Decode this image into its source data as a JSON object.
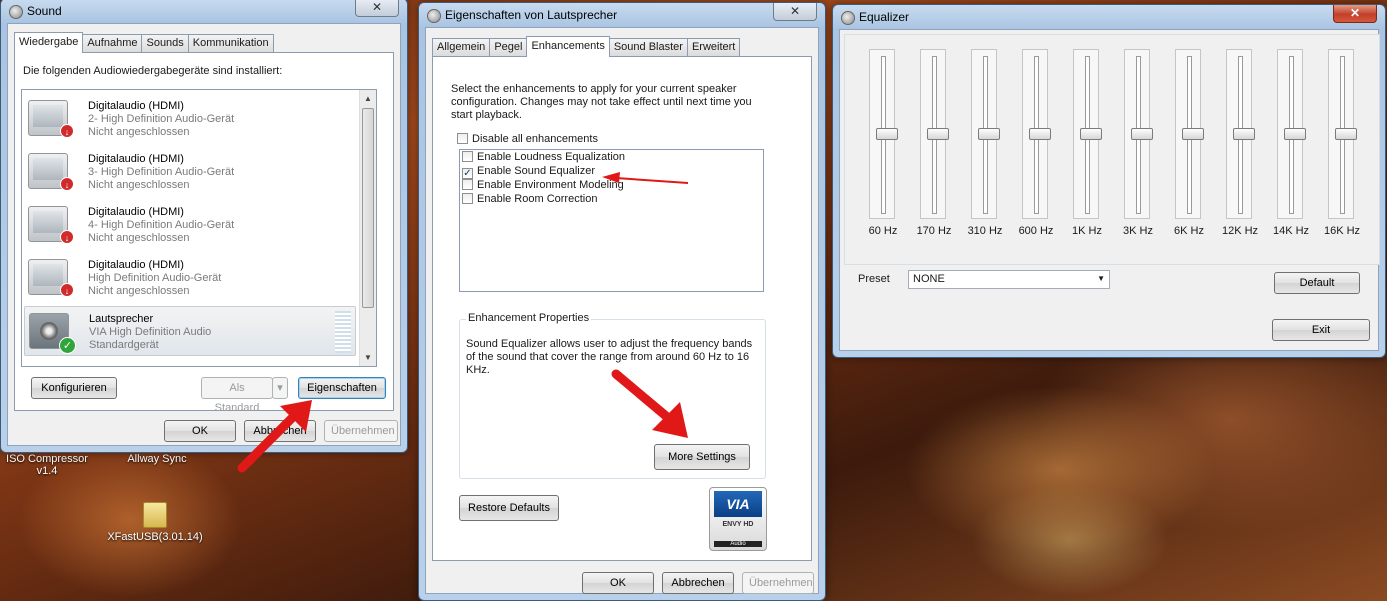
{
  "desktop": {
    "icons": [
      {
        "label": "ISO Compressor v1.4",
        "line1": "ISO Compressor",
        "line2": "v1.4"
      },
      {
        "label": "Allway Sync"
      },
      {
        "label": "XFastUSB(3.01.14)"
      }
    ]
  },
  "sound_window": {
    "title": "Sound",
    "tabs": [
      "Wiedergabe",
      "Aufnahme",
      "Sounds",
      "Kommunikation"
    ],
    "intro": "Die folgenden Audiowiedergabegeräte sind installiert:",
    "devices": [
      {
        "name": "Digitalaudio (HDMI)",
        "desc": "2- High Definition Audio-Gerät",
        "status": "Nicht angeschlossen"
      },
      {
        "name": "Digitalaudio (HDMI)",
        "desc": "3- High Definition Audio-Gerät",
        "status": "Nicht angeschlossen"
      },
      {
        "name": "Digitalaudio (HDMI)",
        "desc": "4- High Definition Audio-Gerät",
        "status": "Nicht angeschlossen"
      },
      {
        "name": "Digitalaudio (HDMI)",
        "desc": "High Definition Audio-Gerät",
        "status": "Nicht angeschlossen"
      },
      {
        "name": "Lautsprecher",
        "desc": "VIA High Definition Audio",
        "status": "Standardgerät"
      }
    ],
    "buttons": {
      "configure": "Konfigurieren",
      "set_default": "Als Standard",
      "properties": "Eigenschaften",
      "ok": "OK",
      "cancel": "Abbrechen",
      "apply": "Übernehmen"
    }
  },
  "properties_window": {
    "title": "Eigenschaften von Lautsprecher",
    "tabs": [
      "Allgemein",
      "Pegel",
      "Enhancements",
      "Sound Blaster",
      "Erweitert"
    ],
    "description": "Select the enhancements to apply for your current speaker configuration. Changes may not take effect until next time you start playback.",
    "disable_all": "Disable all enhancements",
    "enhancements": [
      {
        "label": "Enable Loudness Equalization",
        "checked": ""
      },
      {
        "label": "Enable Sound Equalizer",
        "checked": "✓"
      },
      {
        "label": "Enable Environment Modeling",
        "checked": ""
      },
      {
        "label": "Enable Room Correction",
        "checked": ""
      }
    ],
    "group_title": "Enhancement Properties",
    "group_text": "Sound Equalizer allows user to adjust the frequency bands of the sound that cover the range from around 60 Hz to 16 KHz.",
    "buttons": {
      "more_settings": "More Settings",
      "restore_defaults": "Restore Defaults",
      "ok": "OK",
      "cancel": "Abbrechen",
      "apply": "Übernehmen"
    },
    "logo": {
      "brand": "VIA",
      "line1": "ENVY HD",
      "line2": "Audio"
    }
  },
  "equalizer_window": {
    "title": "Equalizer",
    "bands": [
      {
        "label": "60 Hz",
        "level": 0.5
      },
      {
        "label": "170 Hz",
        "level": 0.5
      },
      {
        "label": "310 Hz",
        "level": 0.5
      },
      {
        "label": "600 Hz",
        "level": 0.5
      },
      {
        "label": "1K Hz",
        "level": 0.5
      },
      {
        "label": "3K Hz",
        "level": 0.5
      },
      {
        "label": "6K Hz",
        "level": 0.5
      },
      {
        "label": "12K Hz",
        "level": 0.5
      },
      {
        "label": "14K Hz",
        "level": 0.5
      },
      {
        "label": "16K Hz",
        "level": 0.5
      }
    ],
    "preset_label": "Preset",
    "preset_value": "NONE",
    "buttons": {
      "default": "Default",
      "exit": "Exit"
    }
  },
  "colors": {
    "annotation_arrow": "#e01818",
    "checkmark": "#1c3c6c"
  }
}
